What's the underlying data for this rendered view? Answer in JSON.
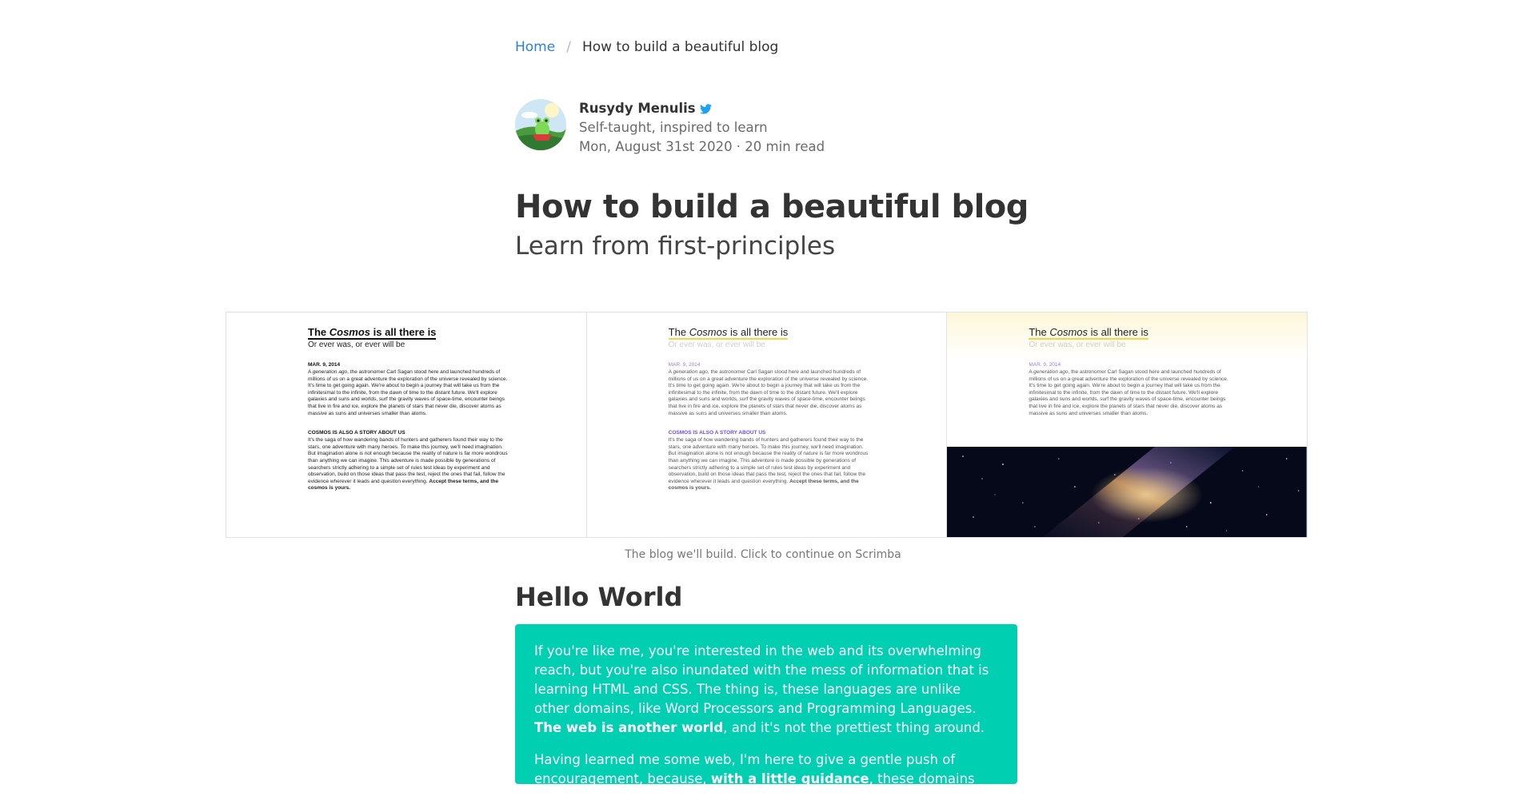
{
  "breadcrumb": {
    "home": "Home",
    "separator": "/",
    "current": "How to build a beautiful blog"
  },
  "author": {
    "name": "Rusydy Menulis",
    "tagline": "Self-taught, inspired to learn",
    "meta": "Mon, August 31st 2020 · 20 min read",
    "social_icon": "twitter-icon",
    "avatar_icon": "frog-avatar"
  },
  "post": {
    "title": "How to build a beautiful blog",
    "subtitle": "Learn from first-principles"
  },
  "preview": {
    "caption": "The blog we'll build. Click to continue on Scrimba",
    "panels": [
      {
        "title_pre": "The ",
        "title_em": "Cosmos",
        "title_post": " is all there is",
        "subtitle": "Or ever was, or ever will be",
        "date": "MAR. 9, 2014",
        "p1_pre": "A ",
        "p1_em": "generation ago",
        "p1_post": ", the astronomer Carl Sagan stood here and launched hundreds of millions of us on a great adventure the exploration of the universe revealed by science. It's time to get going again. We're about to begin a journey that will take us from the infinitesimal to the infinite, from the dawn of time to the distant future. We'll explore galaxies and suns and worlds, surf the gravity waves of space-time, encounter beings that live in fire and ice, explore the planets of stars that never die, discover atoms as massive as suns and universes smaller than atoms.",
        "heading": "COSMOS IS ALSO A STORY ABOUT US",
        "p2": "It's the saga of how wandering bands of hunters and gatherers found their way to the stars, one adventure with many heroes. To make this journey, we'll need imagination. But imagination alone is not enough because the reality of nature is far more wondrous than anything we can imagine. This adventure is made possible by generations of searchers strictly adhering to a simple set of rules test ideas by experiment and observation, build on those ideas that pass the test, reject the ones that fail, follow the evidence wherever it leads and question everything.",
        "p2_bold": "Accept these terms, and the cosmos is yours."
      },
      {
        "title_pre": "The ",
        "title_em": "Cosmos",
        "title_post": " is all there is",
        "subtitle": "Or ever was, or ever will be",
        "date": "MAR. 9, 2014",
        "p1_pre": "A ",
        "p1_em": "generation ago",
        "p1_post": ", the astronomer Carl Sagan stood here and launched hundreds of millions of us on a great adventure the exploration of the universe revealed by science. It's time to get going again. We're about to begin a journey that will take us from the infinitesimal to the infinite, from the dawn of time to the distant future. We'll explore galaxies and suns and worlds, surf the gravity waves of space-time, encounter beings that live in fire and ice, explore the planets of stars that never die, discover atoms as massive as suns and universes smaller than atoms.",
        "heading": "COSMOS IS ALSO A STORY ABOUT US",
        "p2": "It's the saga of how wandering bands of hunters and gatherers found their way to the stars, one adventure with many heroes. To make this journey, we'll need imagination. But imagination alone is not enough because the reality of nature is far more wondrous than anything we can imagine. This adventure is made possible by generations of searchers strictly adhering to a simple set of rules test ideas by experiment and observation, build on those ideas that pass the test, reject the ones that fail, follow the evidence wherever it leads and question everything.",
        "p2_bold": "Accept these terms, and the cosmos is yours."
      },
      {
        "title_pre": "The ",
        "title_em": "Cosmos",
        "title_post": " is all there is",
        "subtitle": "Or ever was, or ever will be",
        "date": "MAR. 9, 2014",
        "p1_pre": "A ",
        "p1_em": "generation ago",
        "p1_post": ", the astronomer Carl Sagan stood here and launched hundreds of millions of us on a great adventure the exploration of the universe revealed by science. It's time to get going again. We're about to begin a journey that will take us from the infinitesimal to the infinite, from the dawn of time to the distant future. We'll explore galaxies and suns and worlds, surf the gravity waves of space-time, encounter beings that live in fire and ice, explore the planets of stars that never die, discover atoms as massive as suns and universes smaller than atoms."
      }
    ]
  },
  "section": {
    "heading": "Hello World",
    "p1_a": "If you're like me, you're interested in the web and its overwhelming reach, but you're also inundated with the mess of information that is learning HTML and CSS. The thing is, these languages are unlike other domains, like Word Processors and Programming Languages. ",
    "p1_b": "The web is another world",
    "p1_c": ", and it's not the prettiest thing around.",
    "p2_a": "Having learned me some web, I'm here to give a gentle push of encouragement, because, ",
    "p2_b": "with a little guidance",
    "p2_c": ", these domains can be a lot"
  },
  "colors": {
    "link": "#2f7fd8",
    "callout_bg": "#00cfb2",
    "twitter": "#1da1f2",
    "accent_underline": "#f6d44a",
    "accent_purple": "#6b4fe0"
  }
}
